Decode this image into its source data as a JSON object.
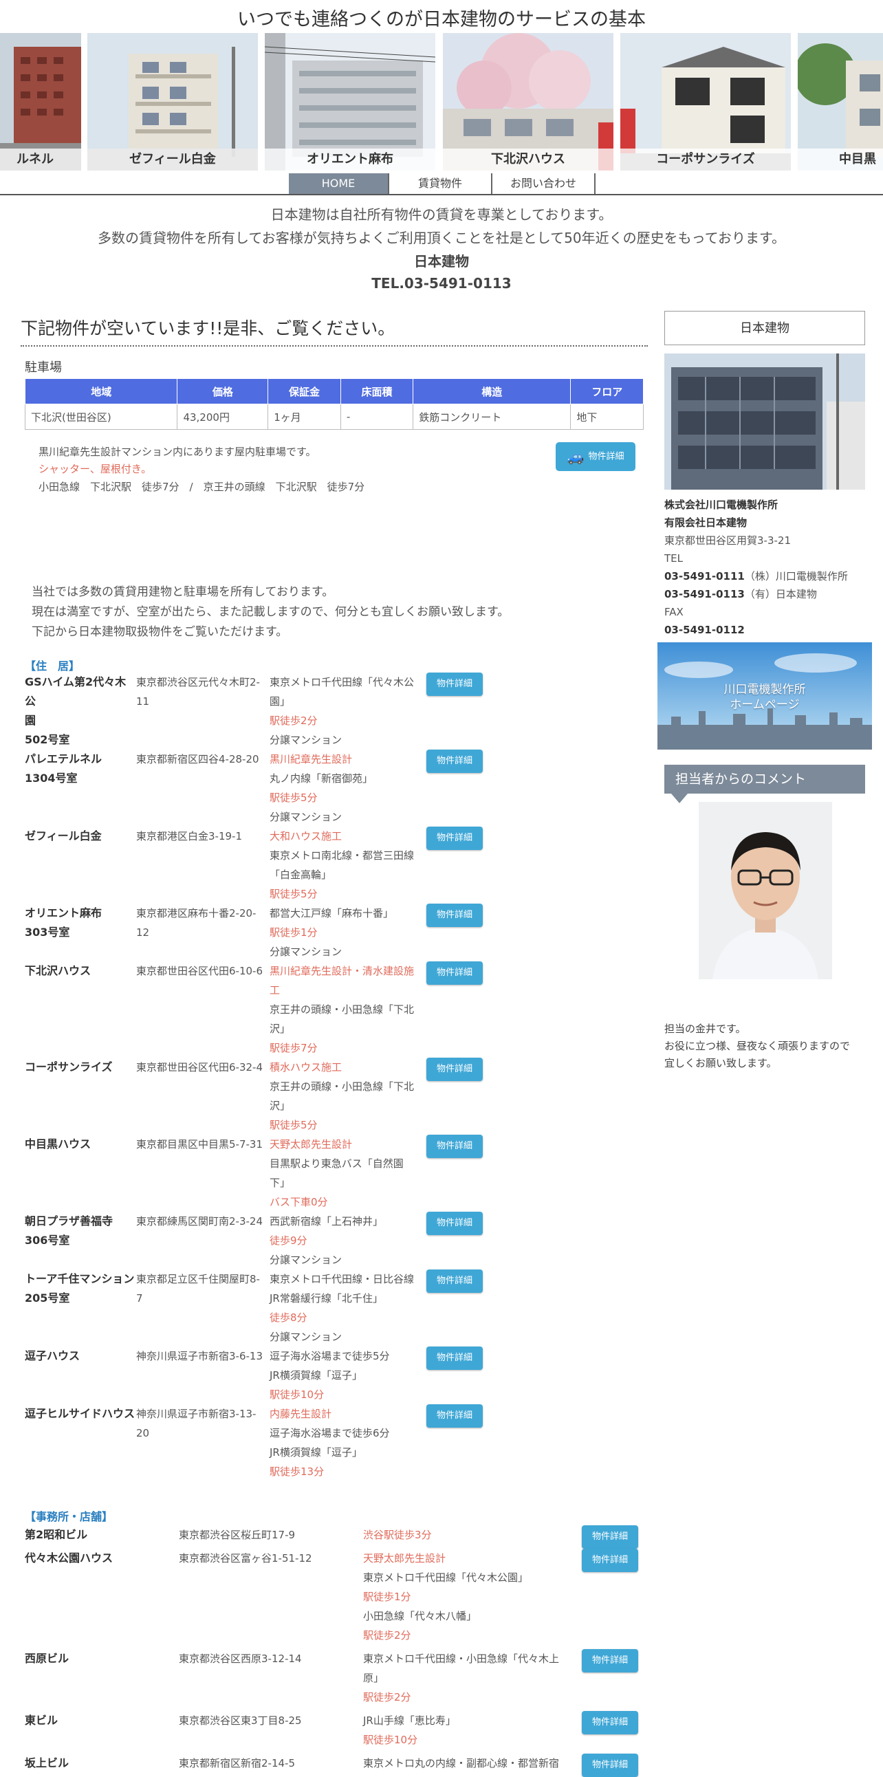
{
  "header": {
    "title": "いつでも連絡つくのが日本建物のサービスの基本",
    "slides": [
      {
        "caption": "ルネル"
      },
      {
        "caption": "ゼフィール白金"
      },
      {
        "caption": "オリエント麻布"
      },
      {
        "caption": "下北沢ハウス"
      },
      {
        "caption": "コーポサンライズ"
      },
      {
        "caption": "中目黒"
      }
    ]
  },
  "nav": {
    "items": [
      {
        "label": "HOME"
      },
      {
        "label": "賃貸物件"
      },
      {
        "label": "お問い合わせ"
      }
    ]
  },
  "intro": {
    "line1": "日本建物は自社所有物件の賃貸を専業としております。",
    "line2": "多数の賃貸物件を所有してお客様が気持ちよくご利用頂くことを社是として50年近くの歴史をもっております。",
    "company": "日本建物",
    "tel": "TEL.03-5491-0113"
  },
  "vacancy": {
    "heading": "下記物件が空いています!!是非、ご覧ください。",
    "parking_label": "駐車場",
    "table_headers": [
      "地域",
      "価格",
      "保証金",
      "床面積",
      "構造",
      "フロア"
    ],
    "table_row": [
      "下北沢(世田谷区)",
      "43,200円",
      "1ヶ月",
      "-",
      "鉄筋コンクリート",
      "地下"
    ],
    "desc1": "黒川紀章先生設計マンション内にあります屋内駐車場です。",
    "desc2": "シャッター、屋根付き。",
    "desc3": "小田急線　下北沢駅　徒歩7分　/　京王井の頭線　下北沢駅　徒歩7分",
    "detail_label": "物件詳細"
  },
  "note": {
    "line1": "当社では多数の賃貸用建物と駐車場を所有しております。",
    "line2": "現在は満室ですが、空室が出たら、また記載しますので、何分とも宜しくお願い致します。",
    "line3": "下記から日本建物取扱物件をご覧いただけます。"
  },
  "residential": {
    "label": "【住　居】",
    "detail_label": "物件詳細",
    "items": [
      {
        "name": [
          "GSハイム第2代々木公",
          "園",
          "502号室"
        ],
        "addr": [
          "東京都渋谷区元代々木町2-",
          "11"
        ],
        "lines": [
          {
            "t": "東京メトロ千代田線「代々木公",
            "red": false
          },
          {
            "t": "園」",
            "red": false
          },
          {
            "t": "駅徒歩2分",
            "red": true
          },
          {
            "t": "分譲マンション",
            "red": false
          }
        ]
      },
      {
        "name": [
          "パレエテルネル",
          "1304号室"
        ],
        "addr": [
          "東京都新宿区四谷4-28-20"
        ],
        "lines": [
          {
            "t": "黒川紀章先生設計",
            "red": true
          },
          {
            "t": "丸ノ内線「新宿御苑」",
            "red": false
          },
          {
            "t": "駅徒歩5分",
            "red": true
          },
          {
            "t": "分譲マンション",
            "red": false
          }
        ]
      },
      {
        "name": [
          "ゼフィール白金"
        ],
        "addr": [
          "東京都港区白金3-19-1"
        ],
        "lines": [
          {
            "t": "大和ハウス施工",
            "red": true
          },
          {
            "t": "東京メトロ南北線・都営三田線",
            "red": false
          },
          {
            "t": "「白金高輪」",
            "red": false
          },
          {
            "t": "駅徒歩5分",
            "red": true
          }
        ]
      },
      {
        "name": [
          "オリエント麻布",
          "303号室"
        ],
        "addr": [
          "東京都港区麻布十番2-20-",
          "12"
        ],
        "lines": [
          {
            "t": "都営大江戸線「麻布十番」",
            "red": false
          },
          {
            "t": "駅徒歩1分",
            "red": true
          },
          {
            "t": "分譲マンション",
            "red": false
          }
        ]
      },
      {
        "name": [
          "下北沢ハウス"
        ],
        "addr": [
          "東京都世田谷区代田6-10-6"
        ],
        "lines": [
          {
            "t": "黒川紀章先生設計・清水建設施",
            "red": true
          },
          {
            "t": "工",
            "red": true
          },
          {
            "t": "京王井の頭線・小田急線「下北",
            "red": false
          },
          {
            "t": "沢」",
            "red": false
          },
          {
            "t": "駅徒歩7分",
            "red": true
          }
        ]
      },
      {
        "name": [
          "コーポサンライズ"
        ],
        "addr": [
          "東京都世田谷区代田6-32-4"
        ],
        "lines": [
          {
            "t": "積水ハウス施工",
            "red": true
          },
          {
            "t": "京王井の頭線・小田急線「下北",
            "red": false
          },
          {
            "t": "沢」",
            "red": false
          },
          {
            "t": "駅徒歩5分",
            "red": true
          }
        ]
      },
      {
        "name": [
          "中目黒ハウス"
        ],
        "addr": [
          "東京都目黒区中目黒5-7-31"
        ],
        "lines": [
          {
            "t": "天野太郎先生設計",
            "red": true
          },
          {
            "t": "目黒駅より東急バス「自然園",
            "red": false
          },
          {
            "t": "下」",
            "red": false
          },
          {
            "t": "バス下車0分",
            "red": true
          }
        ]
      },
      {
        "name": [
          "朝日プラザ善福寺",
          "306号室"
        ],
        "addr": [
          "東京都練馬区関町南2-3-24"
        ],
        "lines": [
          {
            "t": "西武新宿線「上石神井」",
            "red": false
          },
          {
            "t": "徒歩9分",
            "red": true
          },
          {
            "t": "分譲マンション",
            "red": false
          }
        ]
      },
      {
        "name": [
          "トーア千住マンション",
          "205号室"
        ],
        "addr": [
          "東京都足立区千住関屋町8-",
          "7"
        ],
        "lines": [
          {
            "t": "東京メトロ千代田線・日比谷線",
            "red": false
          },
          {
            "t": "JR常磐緩行線「北千住」",
            "red": false
          },
          {
            "t": "徒歩8分",
            "red": true
          },
          {
            "t": "分譲マンション",
            "red": false
          }
        ]
      },
      {
        "name": [
          "逗子ハウス"
        ],
        "addr": [
          "神奈川県逗子市新宿3-6-13"
        ],
        "lines": [
          {
            "t": "逗子海水浴場まで徒歩5分",
            "red": false
          },
          {
            "t": "JR横須賀線「逗子」",
            "red": false
          },
          {
            "t": "駅徒歩10分",
            "red": true
          }
        ]
      },
      {
        "name": [
          "逗子ヒルサイドハウス"
        ],
        "addr": [
          "神奈川県逗子市新宿3-13-",
          "20"
        ],
        "lines": [
          {
            "t": "内藤先生設計",
            "red": true
          },
          {
            "t": "逗子海水浴場まで徒歩6分",
            "red": false
          },
          {
            "t": "JR横須賀線「逗子」",
            "red": false
          },
          {
            "t": "駅徒歩13分",
            "red": true
          }
        ]
      }
    ]
  },
  "office": {
    "label": "【事務所・店舗】",
    "detail_label": "物件詳細",
    "items": [
      {
        "name": "第2昭和ビル",
        "addr": "東京都渋谷区桜丘町17-9",
        "lines": [
          {
            "t": "渋谷駅徒歩3分",
            "red": true
          }
        ]
      },
      {
        "name": "代々木公園ハウス",
        "addr": "東京都渋谷区富ヶ谷1-51-12",
        "lines": [
          {
            "t": "天野太郎先生設計",
            "red": true
          },
          {
            "t": "東京メトロ千代田線「代々木公園」",
            "red": false
          },
          {
            "t": "駅徒歩1分",
            "red": true
          },
          {
            "t": "小田急線「代々木八幡」",
            "red": false
          },
          {
            "t": "駅徒歩2分",
            "red": true
          }
        ]
      },
      {
        "name": "西原ビル",
        "addr": "東京都渋谷区西原3-12-14",
        "lines": [
          {
            "t": "東京メトロ千代田線・小田急線「代々木上",
            "red": false
          },
          {
            "t": "原」",
            "red": false
          },
          {
            "t": "駅徒歩2分",
            "red": true
          }
        ]
      },
      {
        "name": "東ビル",
        "addr": "東京都渋谷区東3丁目8-25",
        "lines": [
          {
            "t": "JR山手線「恵比寿」",
            "red": false
          },
          {
            "t": "駅徒歩10分",
            "red": true
          }
        ]
      },
      {
        "name": "坂上ビル",
        "addr": "東京都新宿区新宿2-14-5",
        "lines": [
          {
            "t": "東京メトロ丸の内線・副都心線・都営新宿",
            "red": false
          }
        ]
      }
    ]
  },
  "sidebar": {
    "title": "日本建物",
    "company1": "株式会社川口電機製作所",
    "company2": "有限会社日本建物",
    "address": "東京都世田谷区用賀3-3-21",
    "tel_label": "TEL",
    "tel1_num": "03-5491-0111",
    "tel1_name": "（株）川口電機製作所",
    "tel2_num": "03-5491-0113",
    "tel2_name": "（有）日本建物",
    "fax_label": "FAX",
    "fax_num": "03-5491-0112",
    "banner_line1": "川口電機製作所",
    "banner_line2": "ホームページ",
    "comment_heading": "担当者からのコメント",
    "comment_line1": "担当の金井です。",
    "comment_line2": "お役に立つ様、昼夜なく頑張りますので",
    "comment_line3": "宜しくお願い致します。"
  },
  "colors": {
    "accent_blue": "#3fa7d6",
    "table_header": "#4f6ce0",
    "nav_active": "#7d8a99",
    "highlight_red": "#e06a5a",
    "section_blue": "#2a7fc0"
  }
}
